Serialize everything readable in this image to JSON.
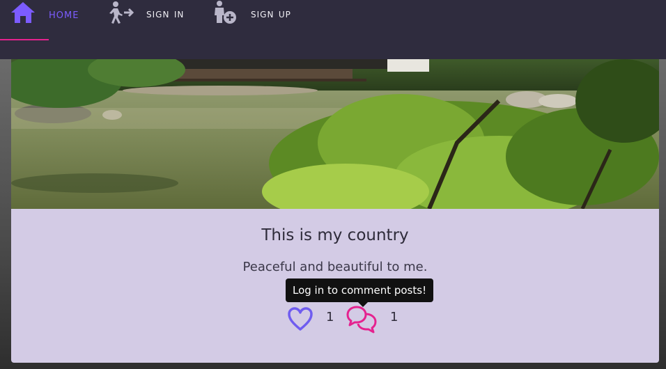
{
  "nav": {
    "home_label": "Home",
    "signin_label": "Sign in",
    "signup_label": "Sign up",
    "icons": {
      "home": "home-icon",
      "signin": "walk-arrow-icon",
      "signup": "person-add-icon"
    },
    "active_color": "#7c5cff",
    "underline_color": "#e5228f"
  },
  "post": {
    "image_alt": "Japanese garden pond with trees",
    "title": "This is my country",
    "content": "Peaceful and beautiful to me.",
    "likes_count": "1",
    "comments_count": "1",
    "tooltip": "Log in to comment posts!",
    "like_color": "#6f5cf0",
    "comment_color": "#e5228f"
  }
}
